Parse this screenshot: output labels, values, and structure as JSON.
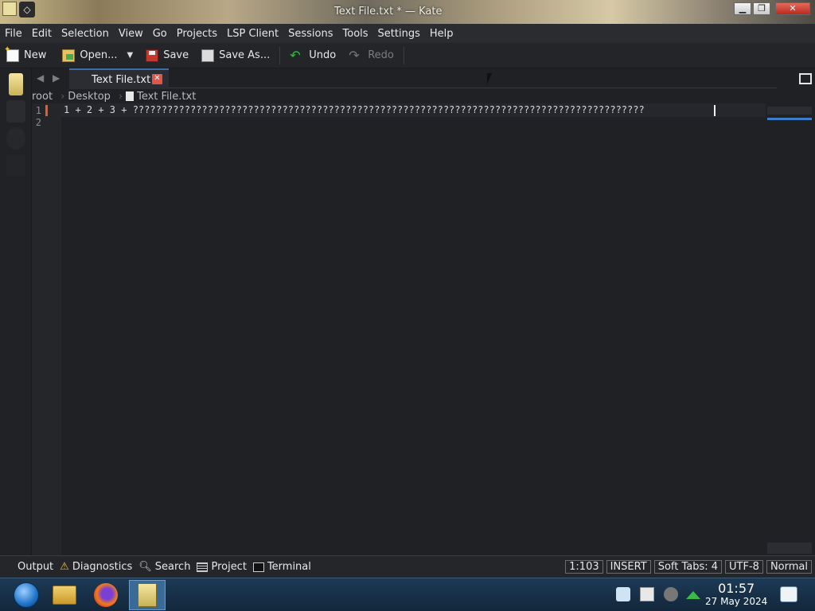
{
  "window": {
    "title": "Text File.txt * — Kate"
  },
  "menu": [
    "File",
    "Edit",
    "Selection",
    "View",
    "Go",
    "Projects",
    "LSP Client",
    "Sessions",
    "Tools",
    "Settings",
    "Help"
  ],
  "toolbar": {
    "new_label": "New",
    "open_label": "Open...",
    "save_label": "Save",
    "save_as_label": "Save As...",
    "undo_label": "Undo",
    "redo_label": "Redo"
  },
  "tab": {
    "label": "Text File.txt"
  },
  "breadcrumb": [
    "root",
    "Desktop",
    "Text File.txt"
  ],
  "editor": {
    "line_numbers": [
      "1",
      "2"
    ],
    "line1": "1 + 2 + 3 + ?????????????????????????????????????????????????????????????????????????????????????????"
  },
  "bottom_panel": {
    "output": "Output",
    "diagnostics": "Diagnostics",
    "search": "Search",
    "project": "Project",
    "terminal": "Terminal"
  },
  "status": {
    "cursor": "1:103",
    "mode": "INSERT",
    "indent": "Soft Tabs: 4",
    "encoding": "UTF-8",
    "input_mode": "Normal"
  },
  "taskbar": {
    "time": "01:57",
    "date": "27 May 2024"
  },
  "colors": {
    "accent": "#3a6fb0",
    "modified": "#e65c2f",
    "tab_close": "#e0564a"
  }
}
